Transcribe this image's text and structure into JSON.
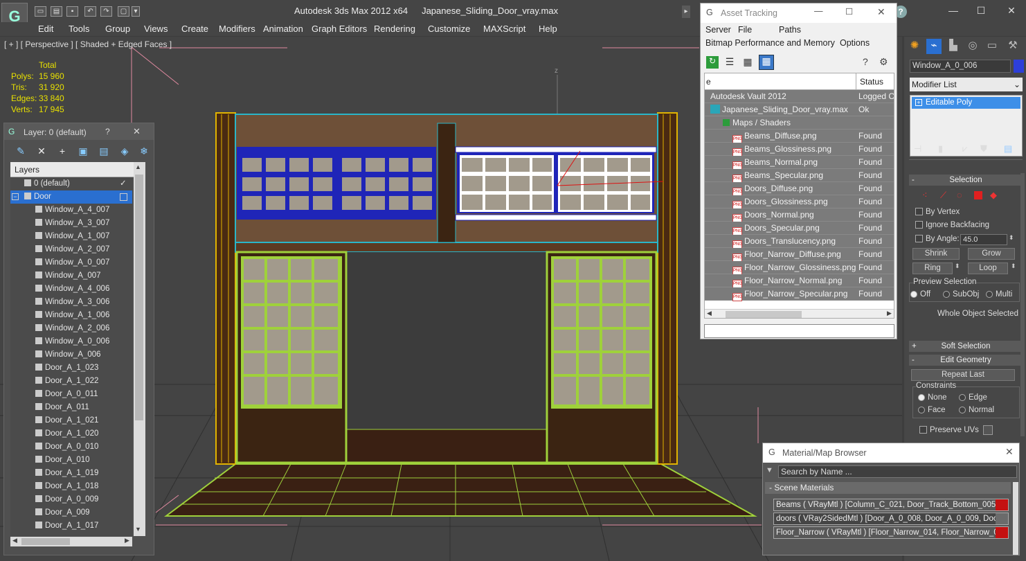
{
  "app": {
    "title": "Autodesk 3ds Max  2012 x64",
    "file": "Japanese_Sliding_Door_vray.max",
    "logo": "3ds-max-logo"
  },
  "menu": [
    "Edit",
    "Tools",
    "Group",
    "Views",
    "Create",
    "Modifiers",
    "Animation",
    "Graph Editors",
    "Rendering",
    "Customize",
    "MAXScript",
    "Help"
  ],
  "viewport": {
    "label": "[ + ] [ Perspective ] [ Shaded + Edged Faces ]",
    "stats": {
      "header": "Total",
      "rows": [
        {
          "k": "Polys:",
          "v": "15 960"
        },
        {
          "k": "Tris:",
          "v": "31 920"
        },
        {
          "k": "Edges:",
          "v": "33 840"
        },
        {
          "k": "Verts:",
          "v": "17 945"
        }
      ]
    },
    "axis_label": "z"
  },
  "layer_panel": {
    "title": "Layer: 0 (default)",
    "help": "?",
    "close": "✕",
    "header": "Layers",
    "items": [
      {
        "label": "0 (default)",
        "level": 0,
        "check": "✓"
      },
      {
        "label": "Door",
        "level": 0,
        "selected": true,
        "expand": "−"
      },
      {
        "label": "Window_A_4_007",
        "level": 1
      },
      {
        "label": "Window_A_3_007",
        "level": 1
      },
      {
        "label": "Window_A_1_007",
        "level": 1
      },
      {
        "label": "Window_A_2_007",
        "level": 1
      },
      {
        "label": "Window_A_0_007",
        "level": 1
      },
      {
        "label": "Window_A_007",
        "level": 1
      },
      {
        "label": "Window_A_4_006",
        "level": 1
      },
      {
        "label": "Window_A_3_006",
        "level": 1
      },
      {
        "label": "Window_A_1_006",
        "level": 1
      },
      {
        "label": "Window_A_2_006",
        "level": 1
      },
      {
        "label": "Window_A_0_006",
        "level": 1
      },
      {
        "label": "Window_A_006",
        "level": 1
      },
      {
        "label": "Door_A_1_023",
        "level": 1
      },
      {
        "label": "Door_A_1_022",
        "level": 1
      },
      {
        "label": "Door_A_0_011",
        "level": 1
      },
      {
        "label": "Door_A_011",
        "level": 1
      },
      {
        "label": "Door_A_1_021",
        "level": 1
      },
      {
        "label": "Door_A_1_020",
        "level": 1
      },
      {
        "label": "Door_A_0_010",
        "level": 1
      },
      {
        "label": "Door_A_010",
        "level": 1
      },
      {
        "label": "Door_A_1_019",
        "level": 1
      },
      {
        "label": "Door_A_1_018",
        "level": 1
      },
      {
        "label": "Door_A_0_009",
        "level": 1
      },
      {
        "label": "Door_A_009",
        "level": 1
      },
      {
        "label": "Door_A_1_017",
        "level": 1
      }
    ]
  },
  "asset_tracking": {
    "title": "Asset Tracking",
    "menu1": [
      "Server",
      "File",
      "Paths"
    ],
    "menu2": [
      "Bitmap Performance and Memory",
      "Options"
    ],
    "col_name": "e",
    "col_status": "Status",
    "rows": [
      {
        "name": "Autodesk Vault 2012",
        "status": "Logged C",
        "icon": "vault-icon",
        "indent": 0
      },
      {
        "name": "Japanese_Sliding_Door_vray.max",
        "status": "Ok",
        "icon": "max-file-icon",
        "indent": 0
      },
      {
        "name": "Maps / Shaders",
        "status": "",
        "icon": "maps-icon",
        "indent": 1
      },
      {
        "name": "Beams_Diffuse.png",
        "status": "Found",
        "icon": "png-icon",
        "indent": 2
      },
      {
        "name": "Beams_Glossiness.png",
        "status": "Found",
        "icon": "png-icon",
        "indent": 2
      },
      {
        "name": "Beams_Normal.png",
        "status": "Found",
        "icon": "png-icon",
        "indent": 2
      },
      {
        "name": "Beams_Specular.png",
        "status": "Found",
        "icon": "png-icon",
        "indent": 2
      },
      {
        "name": "Doors_Diffuse.png",
        "status": "Found",
        "icon": "png-icon",
        "indent": 2
      },
      {
        "name": "Doors_Glossiness.png",
        "status": "Found",
        "icon": "png-icon",
        "indent": 2
      },
      {
        "name": "Doors_Normal.png",
        "status": "Found",
        "icon": "png-icon",
        "indent": 2
      },
      {
        "name": "Doors_Specular.png",
        "status": "Found",
        "icon": "png-icon",
        "indent": 2
      },
      {
        "name": "Doors_Translucency.png",
        "status": "Found",
        "icon": "png-icon",
        "indent": 2
      },
      {
        "name": "Floor_Narrow_Diffuse.png",
        "status": "Found",
        "icon": "png-icon",
        "indent": 2
      },
      {
        "name": "Floor_Narrow_Glossiness.png",
        "status": "Found",
        "icon": "png-icon",
        "indent": 2
      },
      {
        "name": "Floor_Narrow_Normal.png",
        "status": "Found",
        "icon": "png-icon",
        "indent": 2
      },
      {
        "name": "Floor_Narrow_Specular.png",
        "status": "Found",
        "icon": "png-icon",
        "indent": 2
      }
    ],
    "png_tag": "PNG"
  },
  "command_panel": {
    "object_name": "Window_A_0_006",
    "object_color": "#2d3fd9",
    "modifier_list": "Modifier List",
    "modifier": "Editable Poly",
    "selection": {
      "title": "Selection",
      "by_vertex": "By Vertex",
      "ignore_backfacing": "Ignore Backfacing",
      "by_angle": "By Angle:",
      "angle": "45.0",
      "shrink": "Shrink",
      "grow": "Grow",
      "ring": "Ring",
      "loop": "Loop",
      "preview_selection": "Preview Selection",
      "off": "Off",
      "subobj": "SubObj",
      "multi": "Multi",
      "whole_object": "Whole Object Selected"
    },
    "soft_selection": "Soft Selection",
    "edit_geometry": "Edit Geometry",
    "repeat_last": "Repeat Last",
    "constraints": "Constraints",
    "none": "None",
    "edge": "Edge",
    "face": "Face",
    "normal": "Normal",
    "preserve_uvs": "Preserve UVs"
  },
  "material_browser": {
    "title": "Material/Map Browser",
    "search_placeholder": "Search by Name ...",
    "section": "Scene Materials",
    "materials": [
      {
        "label": "Beams  ( VRayMtl )  [Column_C_021, Door_Track_Bottom_005,...",
        "swatch": "#c41111"
      },
      {
        "label": "doors  ( VRay2SidedMtl )  [Door_A_0_008, Door_A_0_009, Doo...",
        "swatch": "#6b6b6b"
      },
      {
        "label": "Floor_Narrow  ( VRayMtl )  [Floor_Narrow_014, Floor_Narrow_0...",
        "swatch": "#c41111"
      }
    ]
  }
}
